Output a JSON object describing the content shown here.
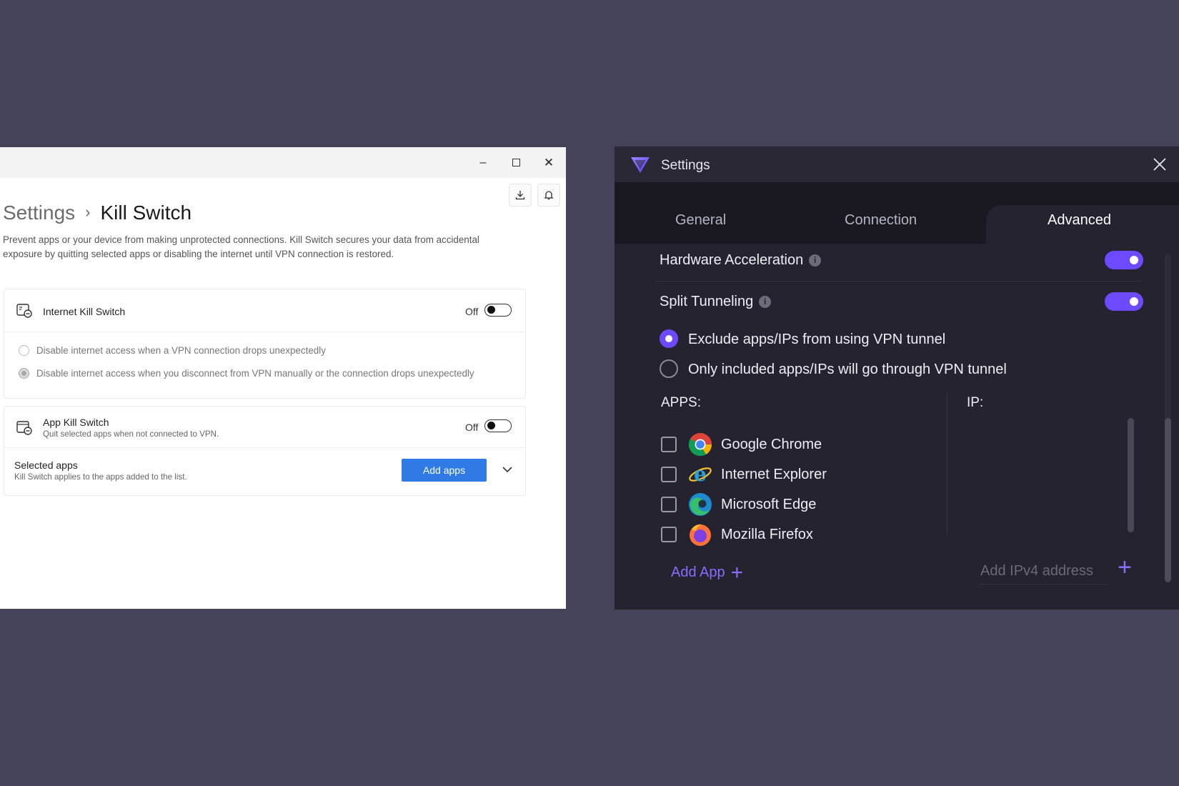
{
  "left_window": {
    "breadcrumb": {
      "root": "Settings",
      "separator": "›",
      "current": "Kill Switch"
    },
    "description": "Prevent apps or your device from making unprotected connections. Kill Switch secures your data from accidental exposure by quitting selected apps or disabling the internet until VPN connection is restored.",
    "internet_kill_switch": {
      "title": "Internet Kill Switch",
      "state_label": "Off",
      "options": [
        "Disable internet access when a VPN connection drops unexpectedly",
        "Disable internet access when you disconnect from VPN manually or the connection drops unexpectedly"
      ]
    },
    "app_kill_switch": {
      "title": "App Kill Switch",
      "subtitle": "Quit selected apps when not connected to VPN.",
      "state_label": "Off"
    },
    "selected_apps": {
      "title": "Selected apps",
      "subtitle": "Kill Switch applies to the apps added to the list.",
      "button": "Add apps"
    }
  },
  "right_window": {
    "title": "Settings",
    "tabs": [
      "General",
      "Connection",
      "Advanced"
    ],
    "active_tab": "Advanced",
    "hardware_acceleration": {
      "label": "Hardware Acceleration",
      "enabled": true
    },
    "split_tunneling": {
      "label": "Split Tunneling",
      "enabled": true
    },
    "modes": [
      "Exclude apps/IPs from using VPN tunnel",
      "Only included apps/IPs will go through VPN tunnel"
    ],
    "apps_header": "APPS:",
    "ip_header": "IP:",
    "apps": [
      "Google Chrome",
      "Internet Explorer",
      "Microsoft Edge",
      "Mozilla Firefox"
    ],
    "add_app_label": "Add App",
    "ip_placeholder": "Add IPv4 address"
  },
  "colors": {
    "background": "#45435a",
    "accent_blue": "#2f7ae5",
    "accent_purple": "#6d4aff",
    "dark_window": "#25232f"
  }
}
